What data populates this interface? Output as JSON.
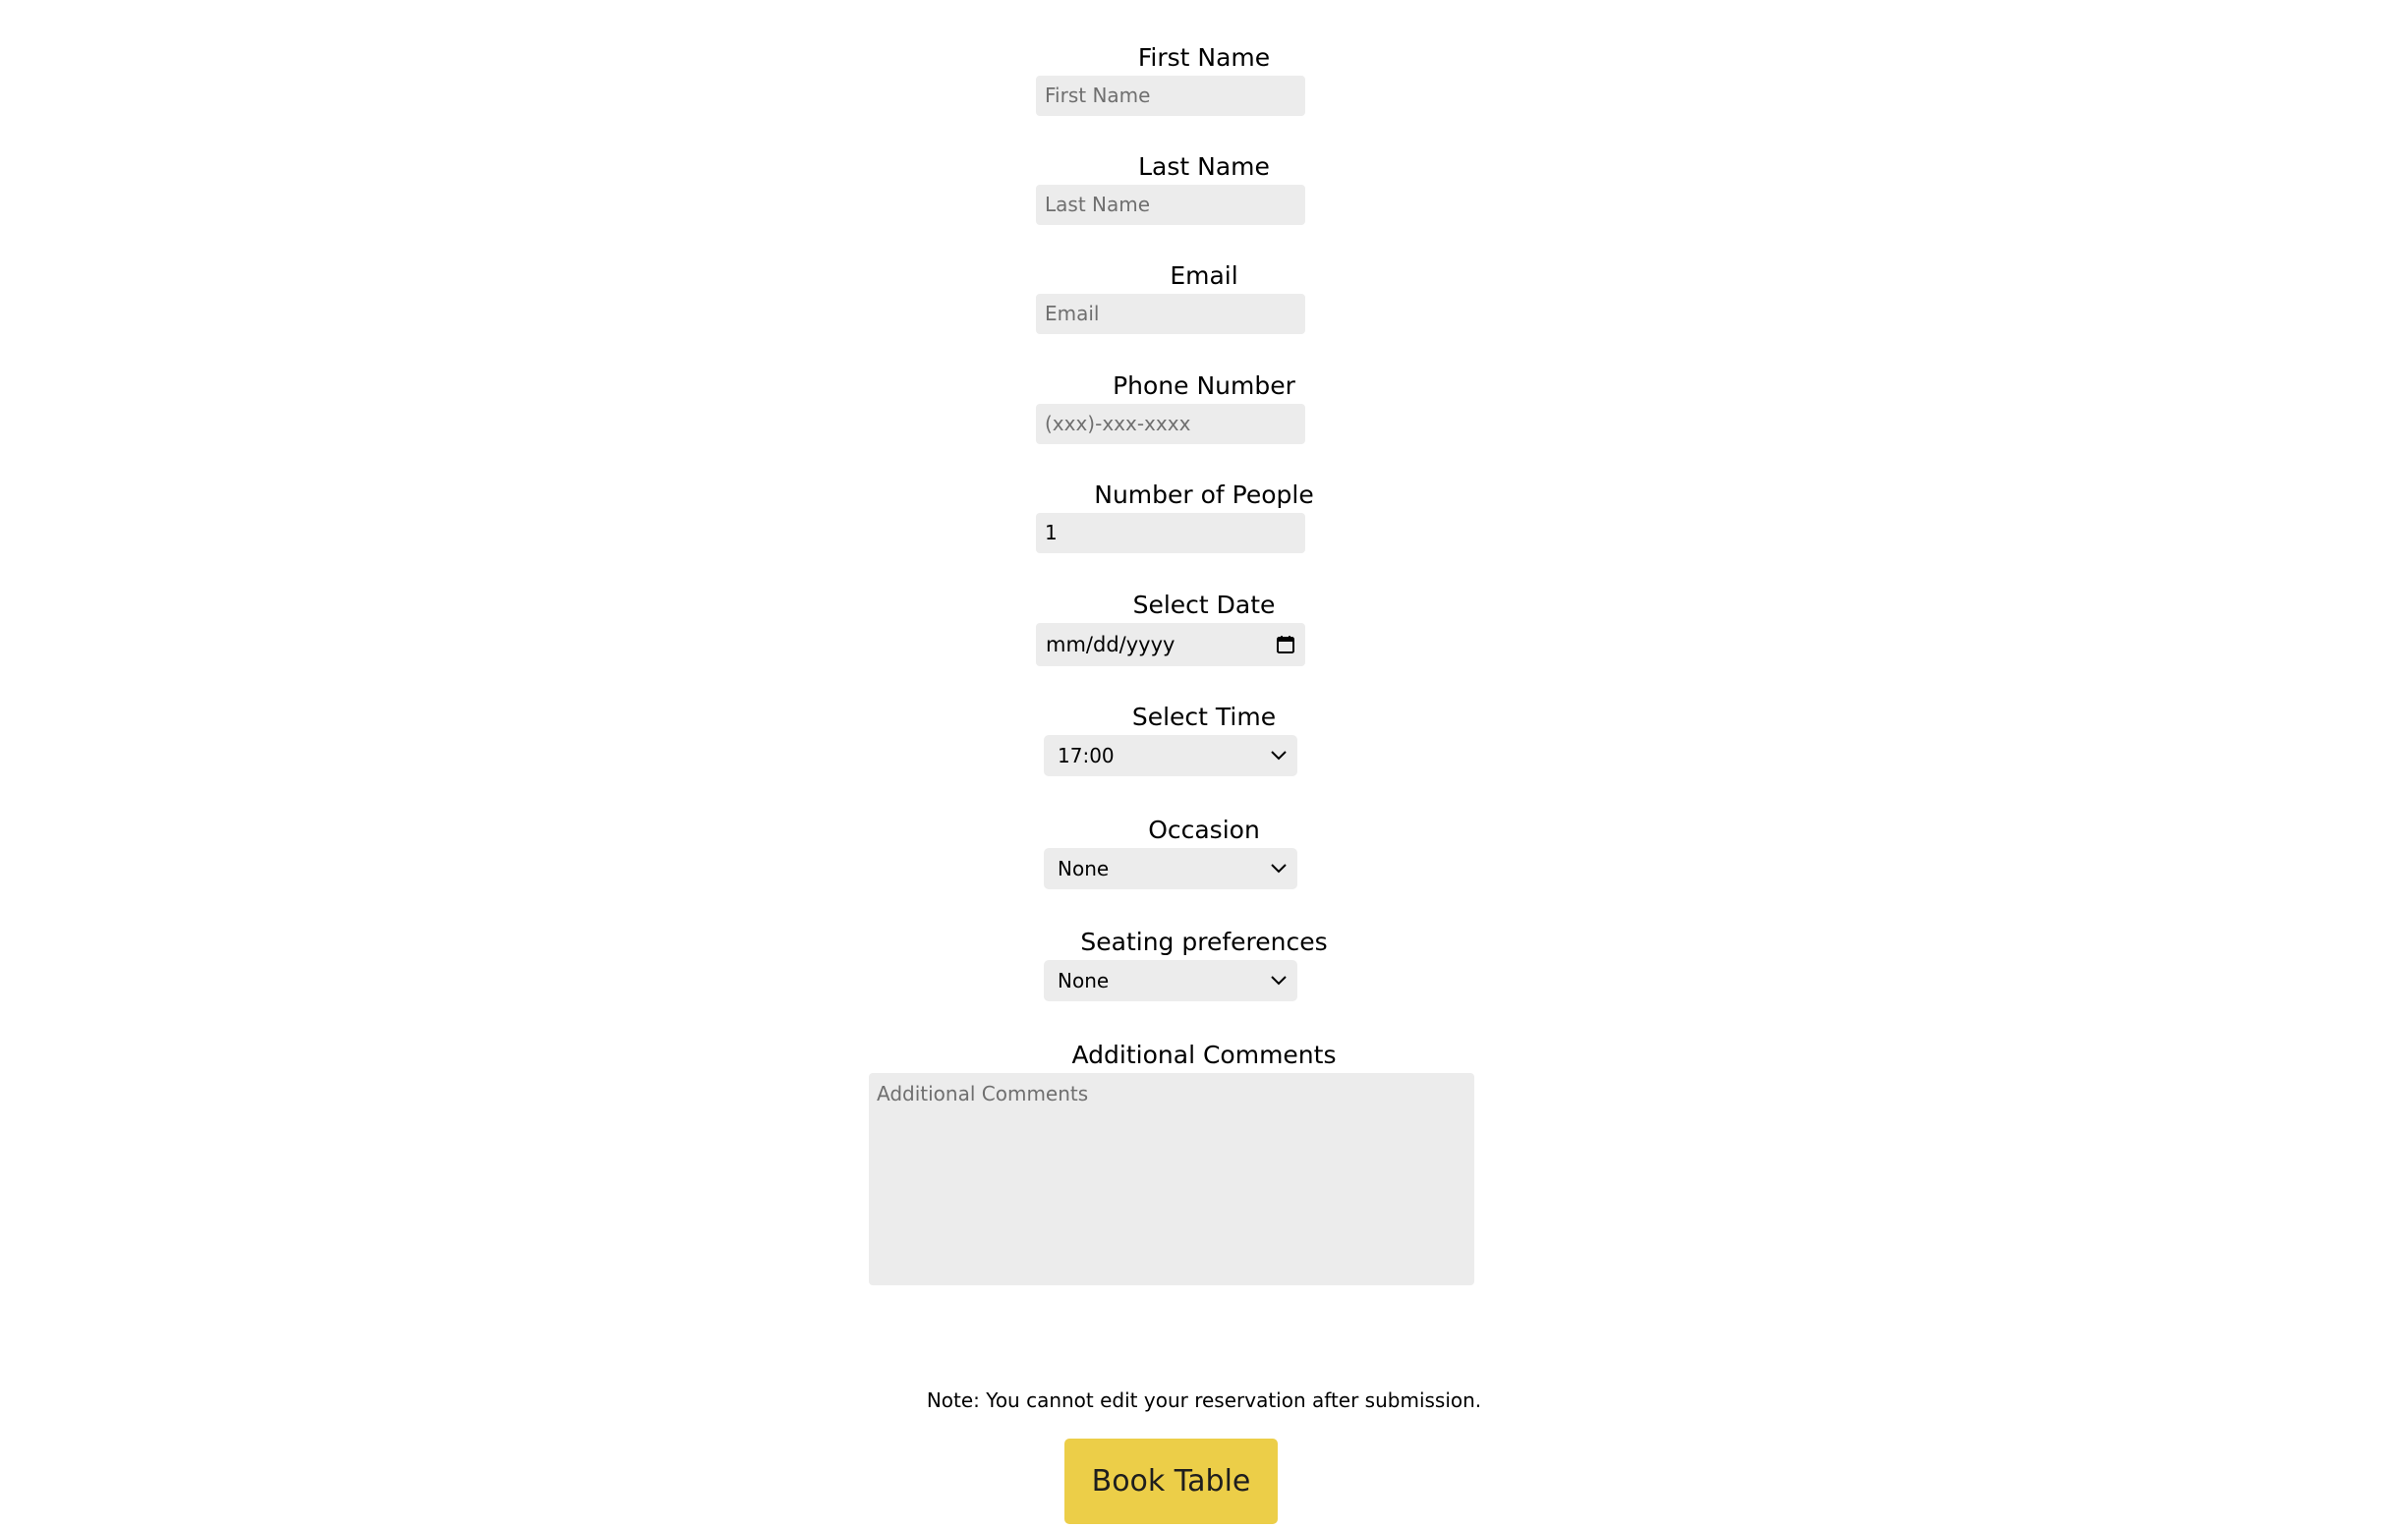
{
  "form": {
    "first_name": {
      "label": "First Name",
      "placeholder": "First Name"
    },
    "last_name": {
      "label": "Last Name",
      "placeholder": "Last Name"
    },
    "email": {
      "label": "Email",
      "placeholder": "Email"
    },
    "phone": {
      "label": "Phone Number",
      "placeholder": "(xxx)-xxx-xxxx"
    },
    "people": {
      "label": "Number of People",
      "value": "1"
    },
    "date": {
      "label": "Select Date",
      "placeholder": "mm/dd/yyyy",
      "icon": "calendar-icon"
    },
    "time": {
      "label": "Select Time",
      "selected": "17:00",
      "icon": "chevron-down-icon"
    },
    "occasion": {
      "label": "Occasion",
      "selected": "None",
      "icon": "chevron-down-icon"
    },
    "seating": {
      "label": "Seating preferences",
      "selected": "None",
      "icon": "chevron-down-icon"
    },
    "comments": {
      "label": "Additional Comments",
      "placeholder": "Additional Comments"
    },
    "note": "Note: You cannot edit your reservation after submission.",
    "submit_label": "Book Table"
  },
  "colors": {
    "input_bg": "#ececec",
    "placeholder": "#6f6f6f",
    "button_bg": "#ecce48"
  }
}
